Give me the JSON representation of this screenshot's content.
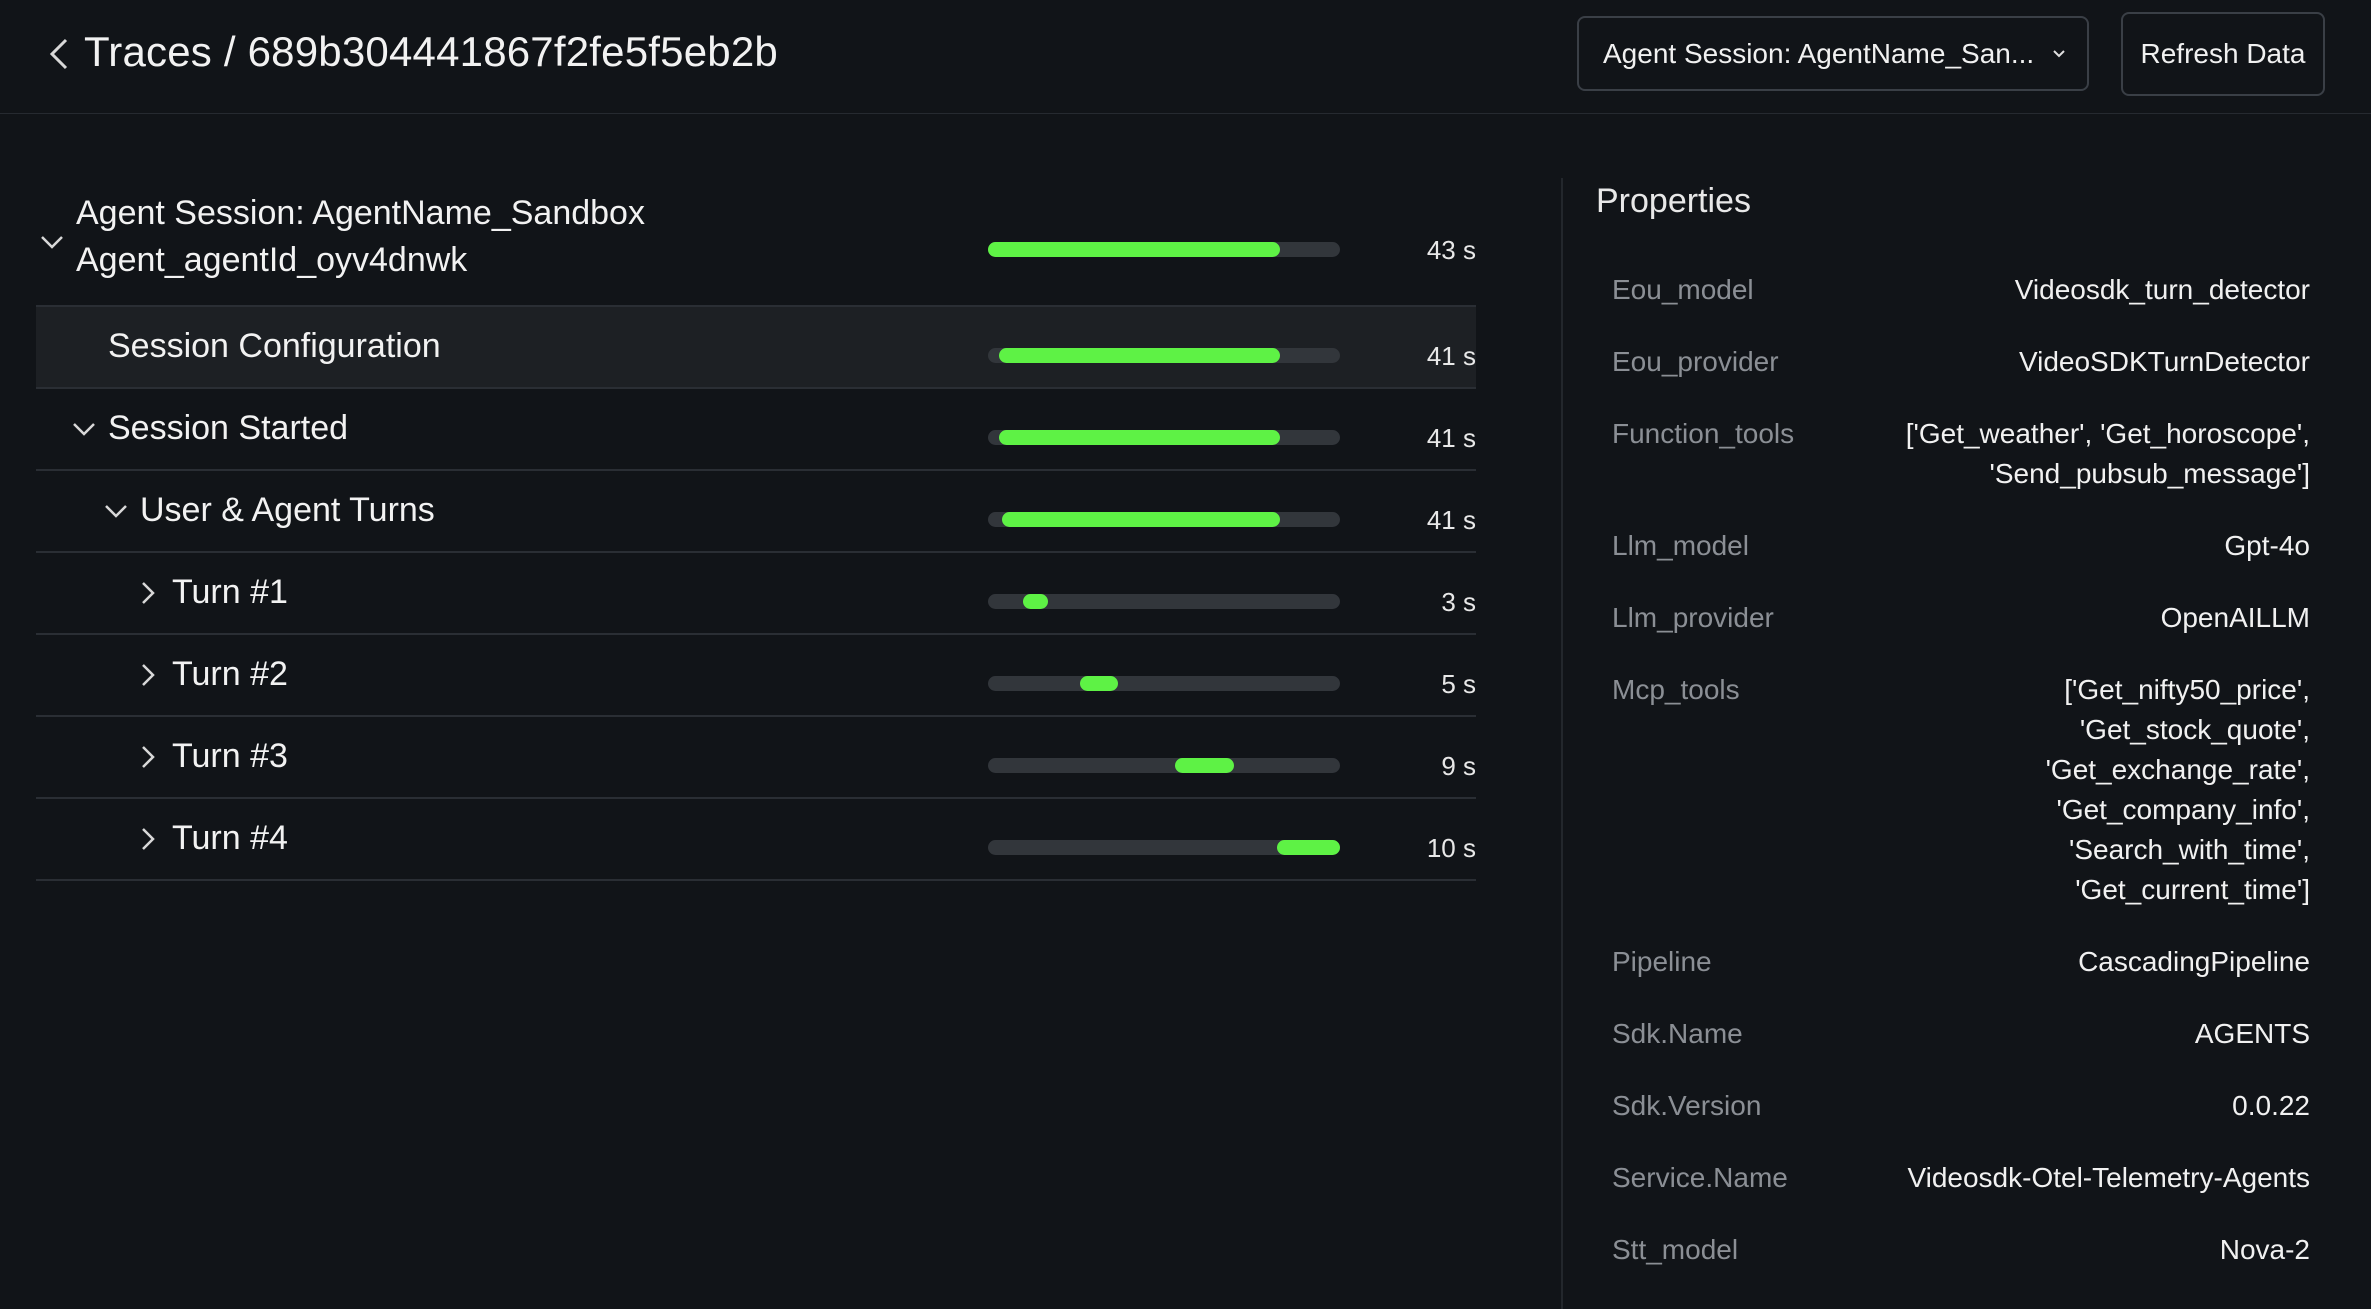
{
  "header": {
    "title": "Traces / 689b304441867f2fe5f5eb2b",
    "session_select": "Agent Session: AgentName_San...",
    "refresh_label": "Refresh Data"
  },
  "trace": {
    "root": {
      "line1": "Agent Session: AgentName_Sandbox",
      "line2": "Agent_agentId_oyv4dnwk",
      "duration": "43 s"
    },
    "rows": [
      {
        "label": "Session Configuration",
        "duration": "41 s",
        "start": 0.03,
        "end": 0.83
      },
      {
        "label": "Session Started",
        "duration": "41 s",
        "start": 0.03,
        "end": 0.83
      },
      {
        "label": "User & Agent Turns",
        "duration": "41 s",
        "start": 0.04,
        "end": 0.83
      },
      {
        "label": "Turn #1",
        "duration": "3 s",
        "start": 0.1,
        "end": 0.17
      },
      {
        "label": "Turn #2",
        "duration": "5 s",
        "start": 0.26,
        "end": 0.37
      },
      {
        "label": "Turn #3",
        "duration": "9 s",
        "start": 0.53,
        "end": 0.7
      },
      {
        "label": "Turn #4",
        "duration": "10 s",
        "start": 0.82,
        "end": 1.0
      }
    ],
    "root_start": 0.0,
    "root_end": 0.83
  },
  "properties": {
    "title": "Properties",
    "items": [
      {
        "key": "Eou_model",
        "value": "Videosdk_turn_detector"
      },
      {
        "key": "Eou_provider",
        "value": "VideoSDKTurnDetector"
      },
      {
        "key": "Function_tools",
        "value": "['Get_weather', 'Get_horoscope',\n'Send_pubsub_message']"
      },
      {
        "key": "Llm_model",
        "value": "Gpt-4o"
      },
      {
        "key": "Llm_provider",
        "value": "OpenAILLM"
      },
      {
        "key": "Mcp_tools",
        "value": "['Get_nifty50_price',\n'Get_stock_quote',\n'Get_exchange_rate',\n'Get_company_info',\n'Search_with_time',\n'Get_current_time']"
      },
      {
        "key": "Pipeline",
        "value": "CascadingPipeline"
      },
      {
        "key": "Sdk.Name",
        "value": "AGENTS"
      },
      {
        "key": "Sdk.Version",
        "value": "0.0.22"
      },
      {
        "key": "Service.Name",
        "value": "Videosdk-Otel-Telemetry-Agents"
      },
      {
        "key": "Stt_model",
        "value": "Nova-2"
      }
    ]
  },
  "colors": {
    "background": "#111418",
    "bar_fill": "#5ef245",
    "bar_track": "#32363b"
  }
}
